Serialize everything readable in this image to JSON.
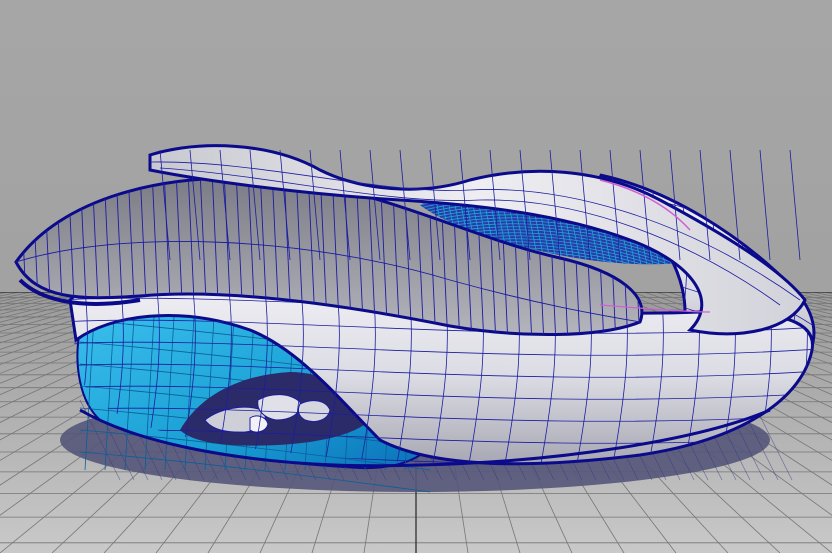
{
  "viewport": {
    "background_color": "#a3a3a3",
    "ground_grid": "on",
    "display_mode": "wireframe-on-shaded",
    "colors": {
      "ground_plane": "#bdbdbd",
      "grid_line": "#767676",
      "grid_major_line": "#3a3a3a",
      "shadow": "#55557a",
      "surface": "#e6e6ec",
      "surface_shade": "#8a8a96",
      "wireframe": "#1c1ca0",
      "edge": "#0a0a8a",
      "glass": "#1a9fd4",
      "glass_deep": "#0a6fb8",
      "highlight": "#d060d0"
    }
  },
  "model": {
    "icon": "architectural-pavilion-model",
    "interior_icons": [
      "interior-seating-model"
    ]
  }
}
